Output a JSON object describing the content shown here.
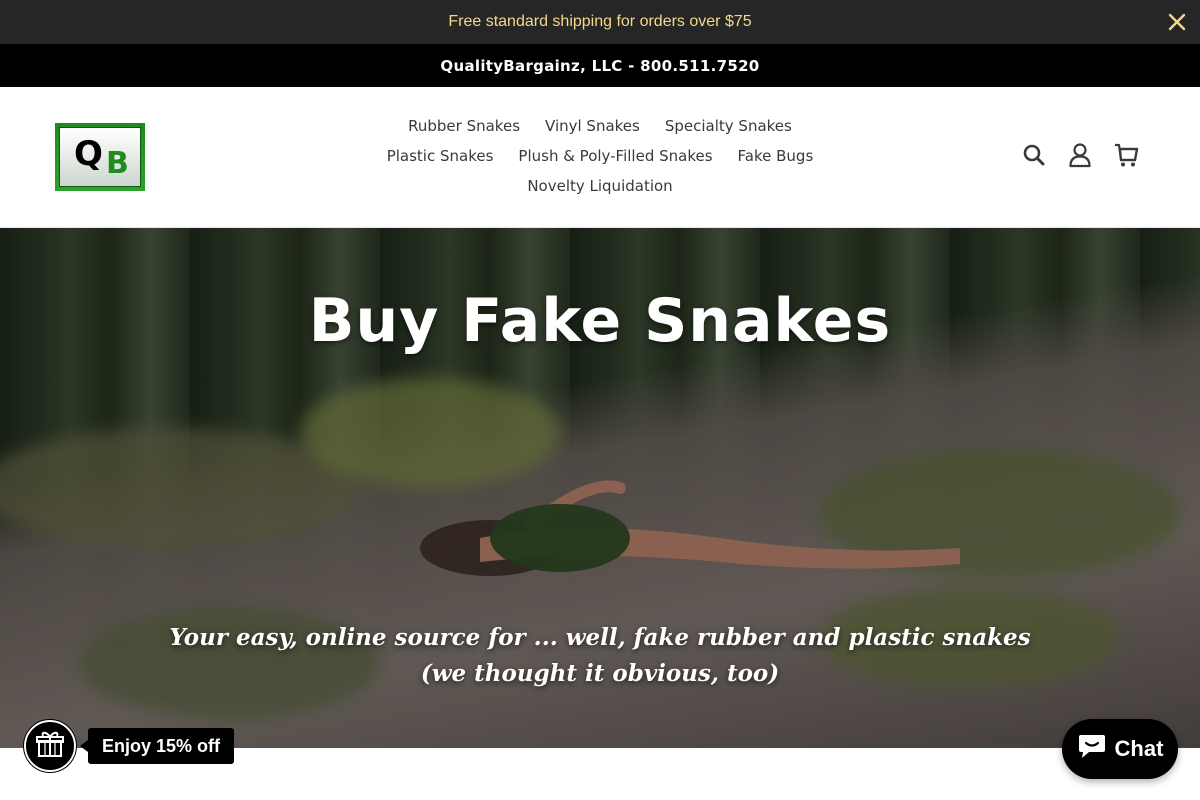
{
  "announcement": {
    "text": "Free standard shipping for orders over $75"
  },
  "company": {
    "text": "QualityBargainz, LLC - 800.511.7520"
  },
  "logo": {
    "letter_q": "Q",
    "letter_b": "B"
  },
  "nav": {
    "row1": [
      "Rubber Snakes",
      "Vinyl Snakes",
      "Specialty Snakes"
    ],
    "row2": [
      "Plastic Snakes",
      "Plush & Poly-Filled Snakes",
      "Fake Bugs"
    ],
    "row3": [
      "Novelty Liquidation"
    ]
  },
  "header_icons": [
    "search-icon",
    "account-icon",
    "cart-icon"
  ],
  "hero": {
    "title": "Buy Fake Snakes",
    "subtitle_line1": "Your easy, online source for ... well, fake rubber and plastic snakes",
    "subtitle_line2": "(we thought it obvious, too)"
  },
  "widgets": {
    "promo_text": "Enjoy 15% off",
    "chat_label": "Chat"
  },
  "colors": {
    "announcement_bg": "#262626",
    "announcement_text": "#f3d98b",
    "company_bg": "#000000",
    "logo_green": "#1e8c1e"
  }
}
